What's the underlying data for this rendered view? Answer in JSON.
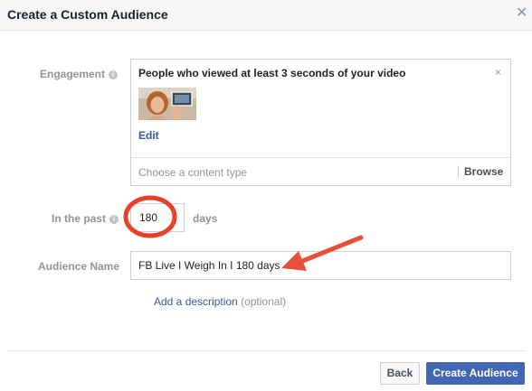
{
  "dialog": {
    "title": "Create a Custom Audience",
    "close_glyph": "✕"
  },
  "engagement": {
    "label": "Engagement",
    "info_glyph": "i",
    "selected_title": "People who viewed at least 3 seconds of your video",
    "remove_glyph": "×",
    "edit_label": "Edit",
    "content_type_placeholder": "Choose a content type",
    "browse_label": "Browse"
  },
  "in_the_past": {
    "label": "In the past",
    "info_glyph": "i",
    "value": "180",
    "suffix": "days"
  },
  "audience_name": {
    "label": "Audience Name",
    "value": "FB Live I Weigh In I 180 days"
  },
  "description": {
    "link_label": "Add a description",
    "optional_label": "(optional)"
  },
  "footer": {
    "back_label": "Back",
    "create_label": "Create Audience"
  },
  "annotations": {
    "circle_color": "#e8402a",
    "arrow_color": "#e8503a"
  },
  "colors": {
    "primary": "#4267b2",
    "link": "#365899",
    "label": "#90949c"
  }
}
